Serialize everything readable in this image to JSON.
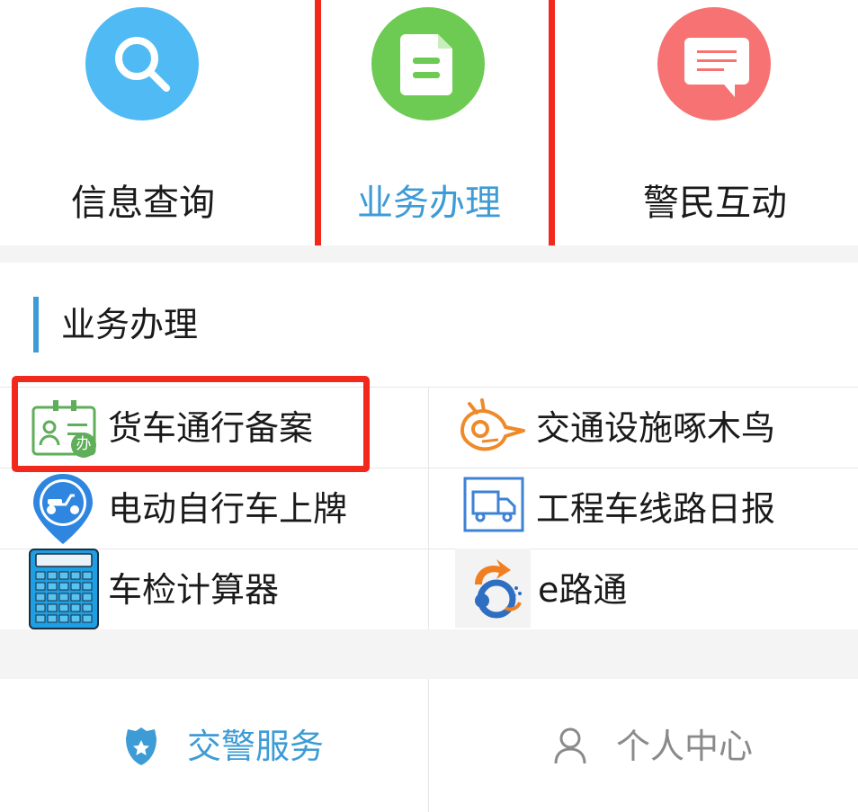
{
  "top_nav": {
    "items": [
      {
        "label": "信息查询",
        "icon": "search-icon",
        "color": "#4fbaf4"
      },
      {
        "label": "业务办理",
        "icon": "document-icon",
        "color": "#6dcb53",
        "active": true
      },
      {
        "label": "警民互动",
        "icon": "message-icon",
        "color": "#f77373"
      }
    ],
    "active_color": "#3d9bd6"
  },
  "section": {
    "title": "业务办理",
    "accent_color": "#3d9bd6",
    "items": [
      {
        "label": "货车通行备案",
        "icon": "truck-permit-badge-icon"
      },
      {
        "label": "交通设施啄木鸟",
        "icon": "woodpecker-icon"
      },
      {
        "label": "电动自行车上牌",
        "icon": "electric-scooter-pin-icon"
      },
      {
        "label": "工程车线路日报",
        "icon": "truck-icon"
      },
      {
        "label": "车检计算器",
        "icon": "calculator-icon"
      },
      {
        "label": "e路通",
        "icon": "e-lutong-logo-icon"
      }
    ]
  },
  "badge_char": "办",
  "tabbar": {
    "tabs": [
      {
        "label": "交警服务",
        "icon": "police-badge-icon",
        "color": "#3d9bd6",
        "active": true
      },
      {
        "label": "个人中心",
        "icon": "person-icon",
        "color": "#8a8a8a"
      }
    ]
  },
  "highlight_color": "#f2281c"
}
